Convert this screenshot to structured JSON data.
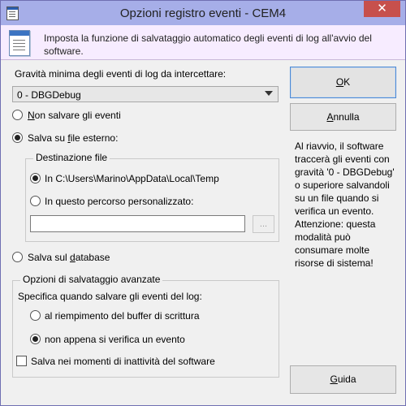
{
  "window": {
    "title": "Opzioni registro eventi - CEM4",
    "close_label": "✕"
  },
  "header": {
    "description": "Imposta la funzione di salvataggio automatico degli eventi di log all'avvio del software."
  },
  "severity": {
    "label": "Gravità minima degli eventi di log da intercettare:",
    "selected": "0 - DBGDebug"
  },
  "options": {
    "no_save": {
      "prefix": "",
      "mnemonic": "N",
      "suffix": "on salvare gli eventi"
    },
    "external_file": {
      "prefix": "Salva su ",
      "mnemonic": "f",
      "suffix": "ile esterno:"
    },
    "database": {
      "prefix": "Salva sul ",
      "mnemonic": "d",
      "suffix": "atabase"
    }
  },
  "destination": {
    "title": "Destinazione file",
    "default_path_option": "In C:\\Users\\Marino\\AppData\\Local\\Temp",
    "custom_path_option": "In questo percorso personalizzato:",
    "custom_path_value": "",
    "browse_label": "..."
  },
  "advanced": {
    "title": "Opzioni di salvataggio avanzate",
    "prompt": "Specifica quando salvare gli eventi del log:",
    "buffer_full": "al riempimento del buffer di scrittura",
    "on_event": "non appena si verifica un evento",
    "idle_save": "Salva nei momenti di inattività del software"
  },
  "buttons": {
    "ok": {
      "mnemonic": "O",
      "suffix": "K"
    },
    "cancel": {
      "mnemonic": "A",
      "suffix": "nnulla"
    },
    "help": {
      "mnemonic": "G",
      "suffix": "uida"
    }
  },
  "info_text": "Al riavvio, il software traccerà gli eventi con gravità '0 - DBGDebug' o superiore salvandoli su un file quando si verifica un evento. Attenzione: questa modalità può consumare molte risorse di sistema!",
  "state": {
    "save_mode": "external_file",
    "destination": "default_path",
    "advanced_mode": "on_event",
    "idle_save": false
  },
  "colors": {
    "titlebar": "#a6aee8",
    "header": "#f7ecff",
    "close": "#c7504c",
    "focus_border": "#4b89d6"
  }
}
